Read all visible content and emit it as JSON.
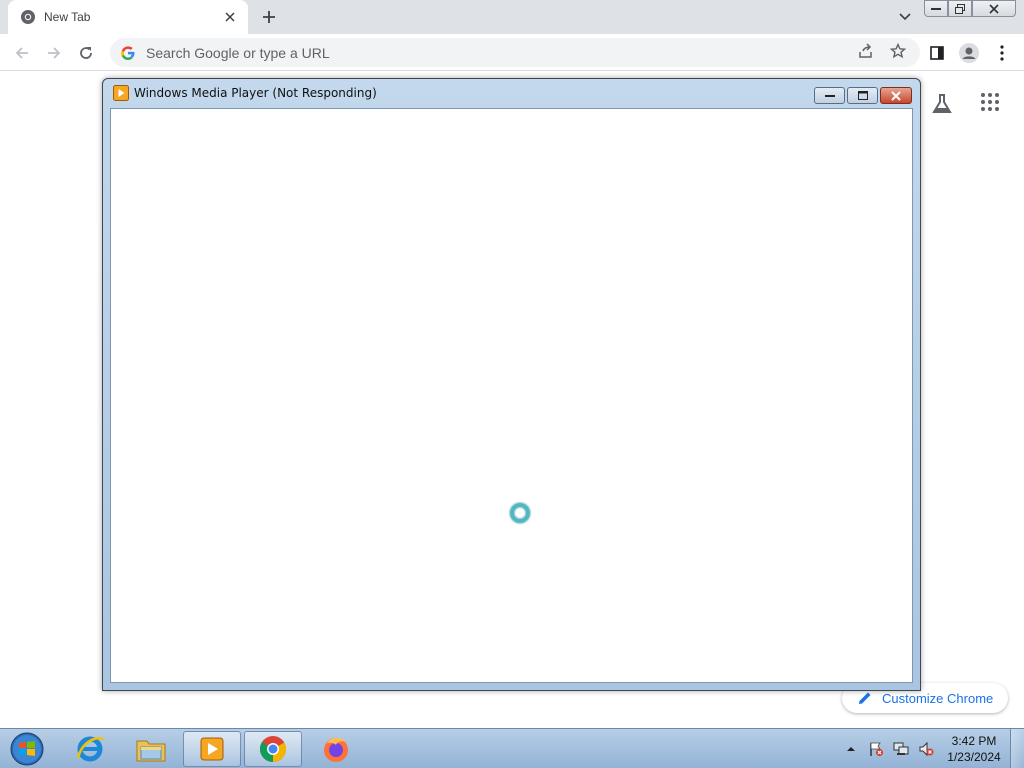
{
  "browser": {
    "tab": {
      "title": "New Tab"
    },
    "omnibox": {
      "placeholder": "Search Google or type a URL"
    }
  },
  "ntp": {
    "customize_label": "Customize Chrome"
  },
  "wmp_window": {
    "title": "Windows Media Player (Not Responding)"
  },
  "taskbar": {
    "apps": [
      "start-orb",
      "internet-explorer",
      "windows-explorer",
      "windows-media-player",
      "google-chrome",
      "firefox"
    ],
    "clock": {
      "time": "3:42 PM",
      "date": "1/23/2024"
    }
  },
  "colors": {
    "chrome_frame": "#dee1e6",
    "accent_blue": "#1a73e8",
    "aero_title": "#c3d8ec",
    "taskbar": "#a5c0de"
  }
}
